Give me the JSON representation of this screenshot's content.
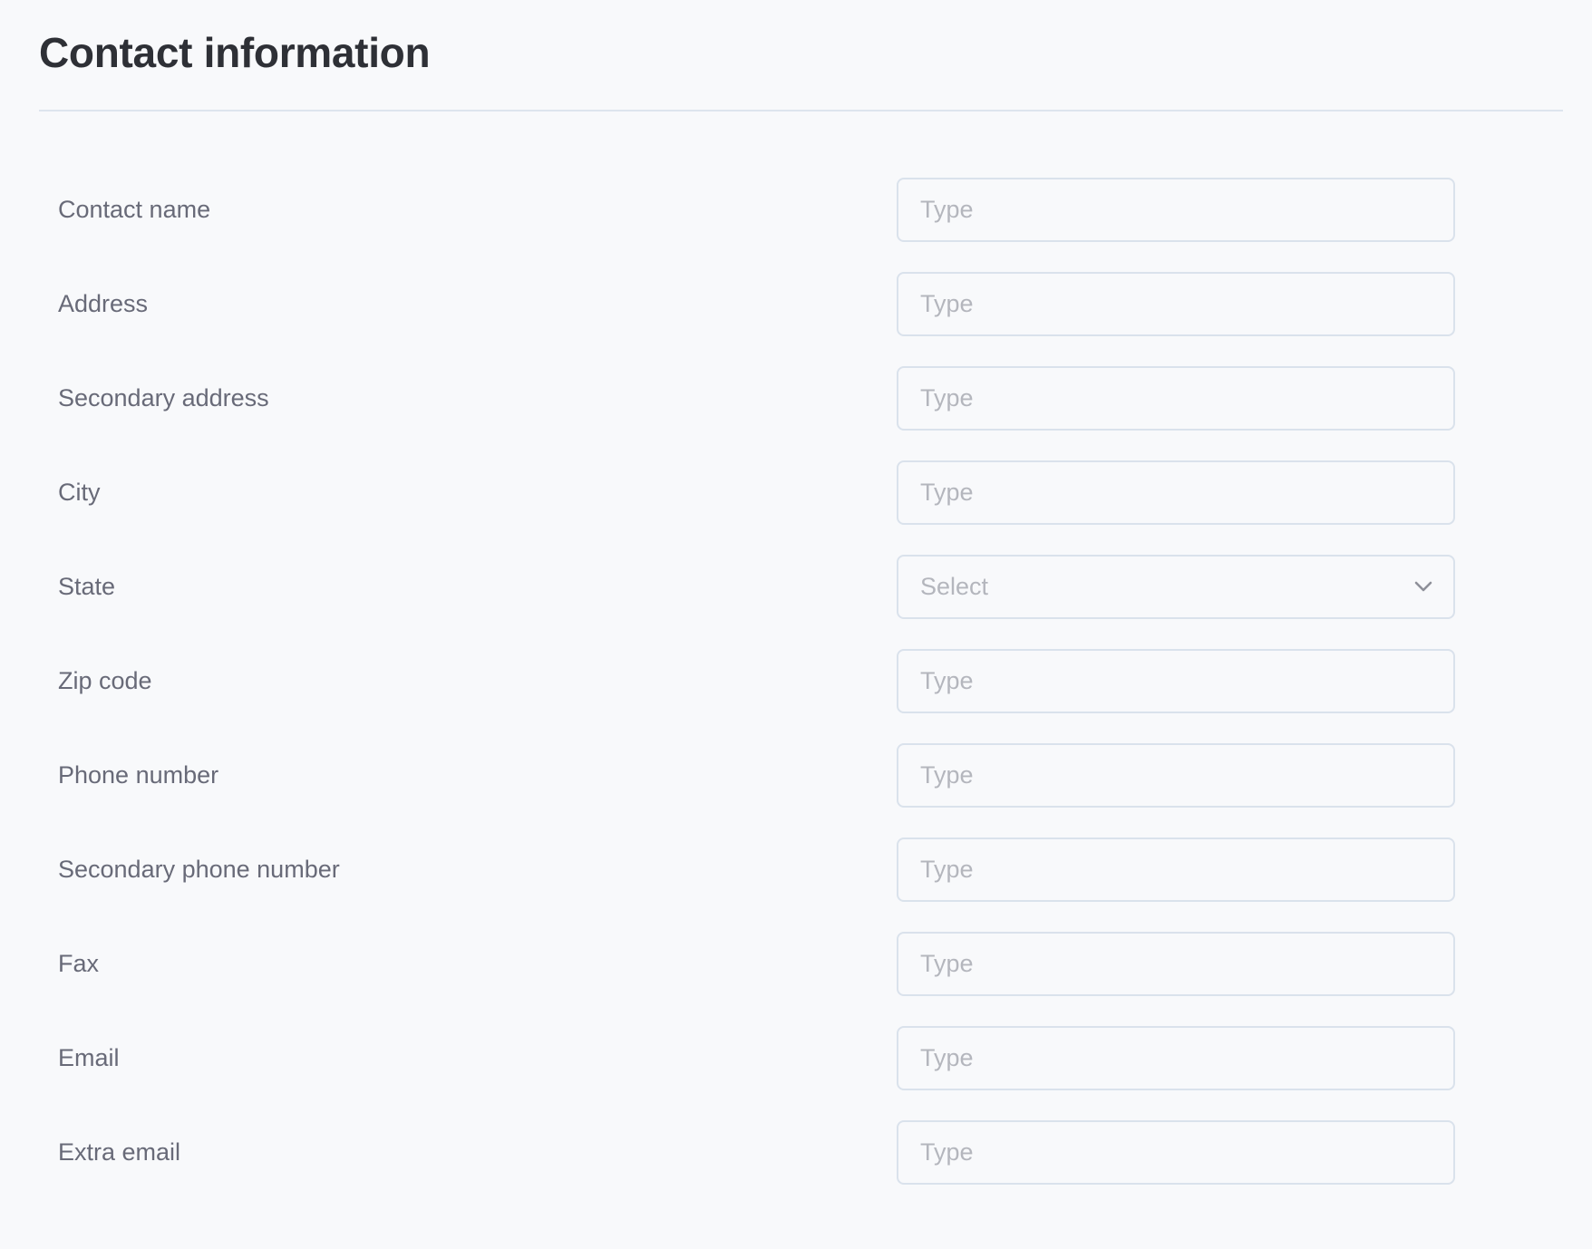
{
  "section": {
    "title": "Contact information"
  },
  "form": {
    "fields": [
      {
        "id": "contact-name",
        "label": "Contact name",
        "type": "text",
        "placeholder": "Type",
        "value": ""
      },
      {
        "id": "address",
        "label": "Address",
        "type": "text",
        "placeholder": "Type",
        "value": ""
      },
      {
        "id": "secondary-address",
        "label": "Secondary address",
        "type": "text",
        "placeholder": "Type",
        "value": ""
      },
      {
        "id": "city",
        "label": "City",
        "type": "text",
        "placeholder": "Type",
        "value": ""
      },
      {
        "id": "state",
        "label": "State",
        "type": "select",
        "placeholder": "Select",
        "value": "",
        "icon": "chevron-down-icon"
      },
      {
        "id": "zip-code",
        "label": "Zip code",
        "type": "text",
        "placeholder": "Type",
        "value": ""
      },
      {
        "id": "phone-number",
        "label": "Phone number",
        "type": "text",
        "placeholder": "Type",
        "value": ""
      },
      {
        "id": "secondary-phone-number",
        "label": "Secondary phone number",
        "type": "text",
        "placeholder": "Type",
        "value": ""
      },
      {
        "id": "fax",
        "label": "Fax",
        "type": "text",
        "placeholder": "Type",
        "value": ""
      },
      {
        "id": "email",
        "label": "Email",
        "type": "text",
        "placeholder": "Type",
        "value": ""
      },
      {
        "id": "extra-email",
        "label": "Extra email",
        "type": "text",
        "placeholder": "Type",
        "value": ""
      }
    ]
  },
  "colors": {
    "background": "#f8f9fb",
    "title": "#2e3036",
    "label": "#686a78",
    "placeholder": "#b4b6bd",
    "border": "#dae2ec"
  }
}
